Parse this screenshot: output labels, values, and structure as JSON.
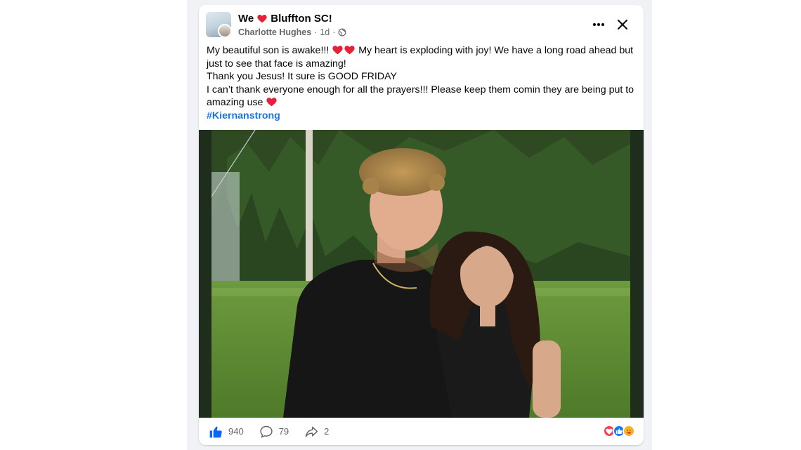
{
  "post": {
    "group": {
      "prefix": "We",
      "suffix": "Bluffton SC!"
    },
    "author": "Charlotte Hughes",
    "time": "1d",
    "separator": "·",
    "privacy_icon": "globe-icon",
    "text": {
      "line1_a": "My beautiful son is awake!!!",
      "line1_b": "My heart is exploding with joy! We have a long road ahead but just to see that face is amazing!",
      "line2": "Thank you Jesus! It sure is GOOD FRIDAY",
      "line3": "I can’t thank everyone enough for all the prayers!!! Please keep them comin they are being put to amazing use",
      "hashtag": "#Kiernanstrong"
    },
    "photo_alt": "Young man with curly blond hair and woman with long dark curly hair standing on grass in front of pine trees"
  },
  "footer": {
    "likes": "940",
    "comments": "79",
    "shares": "2",
    "reactions": [
      "love",
      "like",
      "care"
    ]
  },
  "colors": {
    "accent": "#1b74e4",
    "like_blue": "#0866ff",
    "heart_red": "#e8213a",
    "muted": "#65676b"
  }
}
